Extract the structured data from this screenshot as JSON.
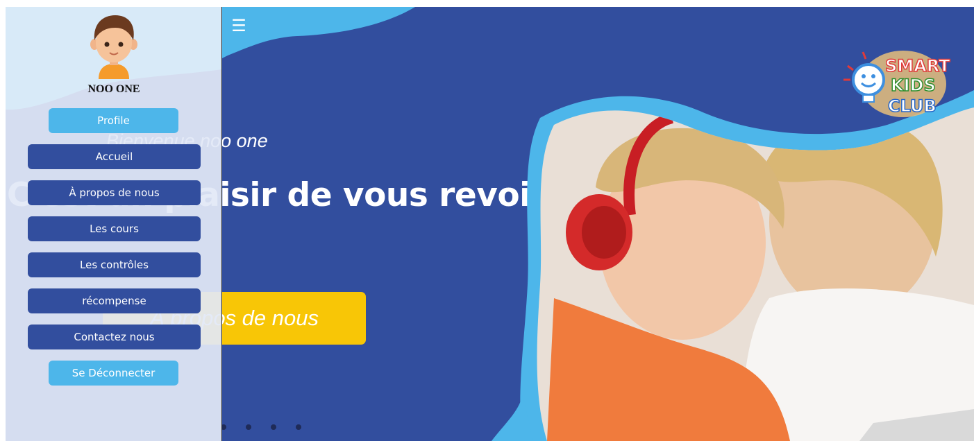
{
  "sidebar": {
    "username": "NOO ONE",
    "profile_label": "Profile",
    "items": [
      {
        "label": "Accueil"
      },
      {
        "label": "À propos de nous"
      },
      {
        "label": "Les cours"
      },
      {
        "label": "Les contrôles"
      },
      {
        "label": "récompense"
      },
      {
        "label": "Contactez nous"
      }
    ],
    "logout_label": "Se Déconnecter"
  },
  "hero": {
    "menu_icon": "hamburger-icon",
    "greeting": "Bienvenue noo one",
    "headline": "C'est un plaisir de vous revoir.",
    "cta_label": "À propos de nous",
    "carousel_dots": 4
  },
  "logo": {
    "word1": "SMART",
    "word2": "KIDS",
    "word3": "CLUB"
  },
  "colors": {
    "hero_blue": "#324e9e",
    "accent_sky": "#4db6ea",
    "cta_yellow": "#f8c606",
    "sidebar_bg": "#e2e8f6"
  }
}
